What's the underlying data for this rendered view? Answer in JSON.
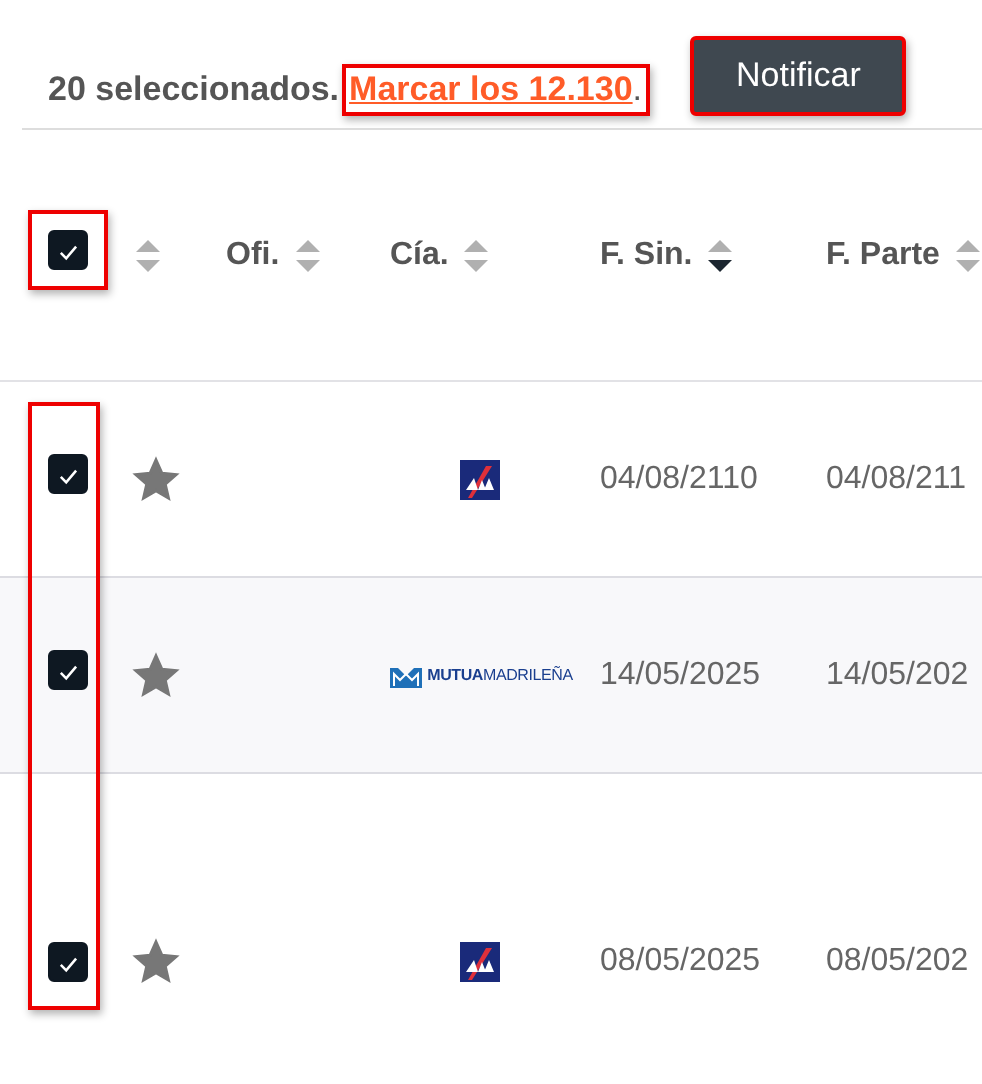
{
  "selection": {
    "text": "20 seleccionados.",
    "link": "Marcar los 12.130",
    "after": ".",
    "link_highlighted": true
  },
  "notify_button": {
    "label": "Notificar",
    "highlighted": true
  },
  "table": {
    "select_all": {
      "checked": true,
      "highlighted": true
    },
    "rows_checkbox_highlighted": true,
    "columns": [
      {
        "sorted_descending": false
      },
      {
        "label": "Ofi.",
        "sorted_descending": false
      },
      {
        "label": "Cía.",
        "sorted_descending": false
      },
      {
        "label": "F. Sin.",
        "sorted_descending": true
      },
      {
        "label": "F. Parte",
        "sorted_descending": false
      }
    ],
    "rows": [
      {
        "checked": true,
        "starred": true,
        "company": {
          "kind": "square"
        },
        "f_sin": "04/08/2110",
        "f_parte": "04/08/211"
      },
      {
        "checked": true,
        "starred": true,
        "company": {
          "kind": "wordmark",
          "bold": "MUTUA",
          "light": "MADRILEÑA"
        },
        "f_sin": "14/05/2025",
        "f_parte": "14/05/202"
      },
      {
        "checked": true,
        "starred": true,
        "company": {
          "kind": "square"
        },
        "f_sin": "08/05/2025",
        "f_parte": "08/05/202"
      }
    ]
  }
}
